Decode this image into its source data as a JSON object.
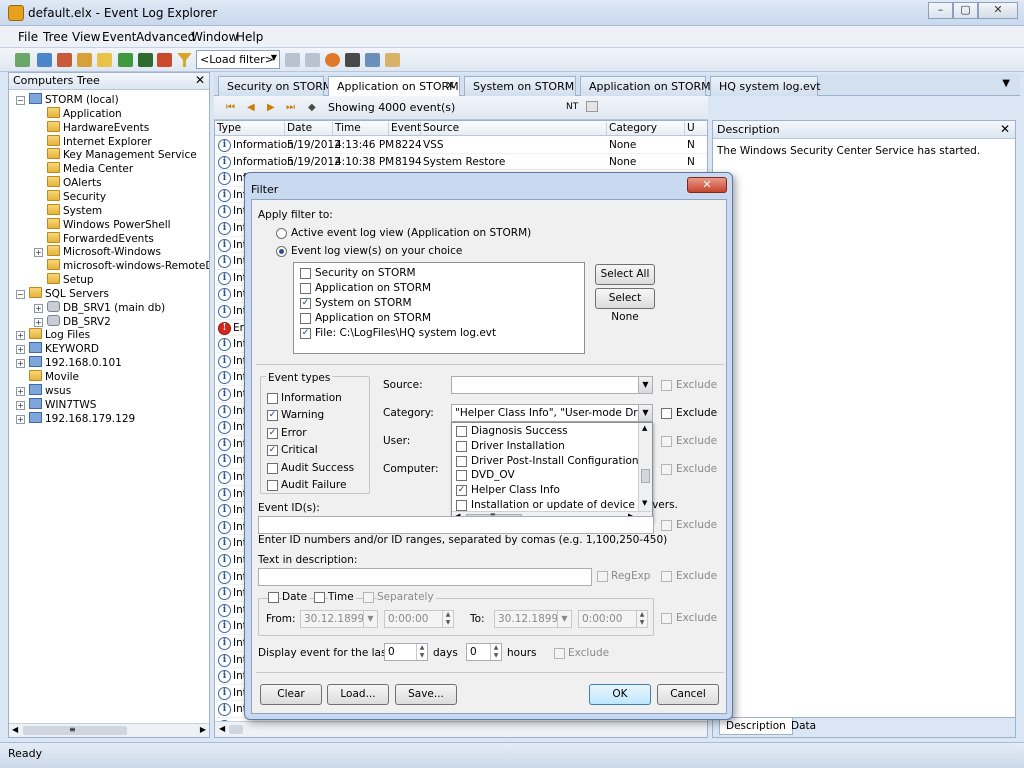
{
  "window": {
    "title": "default.elx - Event Log Explorer",
    "minimize": "–",
    "maximize": "▢",
    "close": "✕"
  },
  "menu": [
    "File",
    "Tree",
    "View",
    "Event",
    "Advanced",
    "Window",
    "Help"
  ],
  "toolbar": {
    "load_filter_value": "<Load filter>"
  },
  "left_pane": {
    "title": "Computers Tree",
    "close": "✕",
    "nodes": [
      {
        "label": "STORM (local)",
        "icon": "computer-icon",
        "indent": 1,
        "expander": "−"
      },
      {
        "label": "Application",
        "icon": "folder-icon",
        "indent": 2
      },
      {
        "label": "HardwareEvents",
        "icon": "folder-icon",
        "indent": 2
      },
      {
        "label": "Internet Explorer",
        "icon": "folder-icon",
        "indent": 2
      },
      {
        "label": "Key Management Service",
        "icon": "folder-icon",
        "indent": 2
      },
      {
        "label": "Media Center",
        "icon": "folder-icon",
        "indent": 2
      },
      {
        "label": "OAlerts",
        "icon": "folder-icon",
        "indent": 2
      },
      {
        "label": "Security",
        "icon": "folder-icon",
        "indent": 2
      },
      {
        "label": "System",
        "icon": "folder-icon",
        "indent": 2
      },
      {
        "label": "Windows PowerShell",
        "icon": "folder-icon",
        "indent": 2
      },
      {
        "label": "ForwardedEvents",
        "icon": "folder-icon",
        "indent": 2
      },
      {
        "label": "Microsoft-Windows",
        "icon": "folder-icon",
        "indent": 2,
        "expander": "+"
      },
      {
        "label": "microsoft-windows-RemoteDesktop",
        "icon": "folder-icon",
        "indent": 2
      },
      {
        "label": "Setup",
        "icon": "folder-icon",
        "indent": 2
      },
      {
        "label": "SQL Servers",
        "icon": "folder-icon",
        "indent": 1,
        "expander": "−"
      },
      {
        "label": "DB_SRV1 (main db)",
        "icon": "database-icon",
        "indent": 2,
        "expander": "+"
      },
      {
        "label": "DB_SRV2",
        "icon": "database-icon",
        "indent": 2,
        "expander": "+"
      },
      {
        "label": "Log Files",
        "icon": "folder-icon",
        "indent": 1,
        "expander": "+"
      },
      {
        "label": "KEYWORD",
        "icon": "computer-icon",
        "indent": 1,
        "expander": "+"
      },
      {
        "label": "192.168.0.101",
        "icon": "computer-icon",
        "indent": 1,
        "expander": "+"
      },
      {
        "label": "Movile",
        "icon": "folder-icon",
        "indent": 1
      },
      {
        "label": "wsus",
        "icon": "computer-icon",
        "indent": 1,
        "expander": "+"
      },
      {
        "label": "WIN7TWS",
        "icon": "computer-icon",
        "indent": 1,
        "expander": "+"
      },
      {
        "label": "192.168.179.129",
        "icon": "computer-icon",
        "indent": 1,
        "expander": "+"
      }
    ]
  },
  "tabs": [
    {
      "label": "Security on STORM",
      "active": false
    },
    {
      "label": "Application on STORM",
      "active": true
    },
    {
      "label": "System on STORM",
      "active": false
    },
    {
      "label": "Application on STORM",
      "active": false
    },
    {
      "label": "HQ system log.evt",
      "active": false
    }
  ],
  "tab_close": "✕",
  "tab_menu": "▼",
  "event_strip": {
    "count": "Showing 4000 event(s)",
    "nt": "NT"
  },
  "grid": {
    "columns": [
      "Type",
      "Date",
      "Time",
      "Event",
      "Source",
      "Category",
      "U"
    ],
    "rows": [
      {
        "type": "Information",
        "date": "5/19/2012",
        "time": "4:13:46 PM",
        "event": "8224",
        "source": "VSS",
        "category": "None",
        "u": "N",
        "icon": "info"
      },
      {
        "type": "Information",
        "date": "5/19/2012",
        "time": "4:10:38 PM",
        "event": "8194",
        "source": "System Restore",
        "category": "None",
        "u": "N",
        "icon": "info"
      },
      {
        "type": "Infor",
        "date": "",
        "time": "",
        "event": "",
        "source": "",
        "category": "",
        "u": "",
        "icon": "info"
      },
      {
        "type": "Info",
        "icon": "info"
      },
      {
        "type": "Int",
        "icon": "info"
      },
      {
        "type": "Int",
        "icon": "info"
      },
      {
        "type": "Int",
        "icon": "info"
      },
      {
        "type": "Int",
        "icon": "info"
      },
      {
        "type": "Int",
        "icon": "info"
      },
      {
        "type": "Int",
        "icon": "info"
      },
      {
        "type": "Int",
        "icon": "info"
      },
      {
        "type": "Er",
        "icon": "error"
      },
      {
        "type": "Int",
        "icon": "info"
      },
      {
        "type": "Int",
        "icon": "info"
      },
      {
        "type": "Int",
        "icon": "info"
      },
      {
        "type": "Int",
        "icon": "info"
      },
      {
        "type": "Int",
        "icon": "info"
      },
      {
        "type": "Int",
        "icon": "info"
      },
      {
        "type": "Int",
        "icon": "info"
      },
      {
        "type": "Int",
        "icon": "info"
      },
      {
        "type": "Int",
        "icon": "info"
      },
      {
        "type": "Int",
        "icon": "info"
      },
      {
        "type": "Int",
        "icon": "info"
      },
      {
        "type": "Int",
        "icon": "info"
      },
      {
        "type": "Int",
        "icon": "info"
      },
      {
        "type": "Int",
        "icon": "info"
      },
      {
        "type": "Int",
        "icon": "info"
      },
      {
        "type": "Int",
        "icon": "info"
      },
      {
        "type": "Int",
        "icon": "info"
      },
      {
        "type": "Int",
        "icon": "info"
      },
      {
        "type": "Int",
        "icon": "info"
      },
      {
        "type": "Int",
        "icon": "info"
      },
      {
        "type": "Int",
        "icon": "info"
      },
      {
        "type": "Int",
        "icon": "info"
      },
      {
        "type": "Int",
        "icon": "info"
      },
      {
        "type": "Int",
        "icon": "info"
      }
    ]
  },
  "description": {
    "title": "Description",
    "close": "✕",
    "text": "The Windows Security Center Service has started.",
    "tabs": [
      "Description",
      "Data"
    ]
  },
  "status": "Ready",
  "dialog": {
    "title": "Filter",
    "close": "✕",
    "apply_filter_to": "Apply filter to:",
    "radio_active": "Active event log view (Application on STORM)",
    "radio_choice": "Event log view(s) on your choice",
    "views": [
      {
        "label": "Security on STORM",
        "checked": false
      },
      {
        "label": "Application on STORM",
        "checked": false
      },
      {
        "label": "System on STORM",
        "checked": true
      },
      {
        "label": "Application on STORM",
        "checked": false
      },
      {
        "label": "File: C:\\LogFiles\\HQ system log.evt",
        "checked": true
      }
    ],
    "select_all": "Select All",
    "select_none": "Select None",
    "event_types_title": "Event types",
    "event_types": [
      {
        "label": "Information",
        "checked": false
      },
      {
        "label": "Warning",
        "checked": true
      },
      {
        "label": "Error",
        "checked": true
      },
      {
        "label": "Critical",
        "checked": true
      },
      {
        "label": "Audit Success",
        "checked": false
      },
      {
        "label": "Audit Failure",
        "checked": false
      }
    ],
    "source_label": "Source:",
    "source_value": "",
    "category_label": "Category:",
    "category_value": "\"Helper Class Info\", \"User-mode Driver probl",
    "user_label": "User:",
    "computer_label": "Computer:",
    "exclude": "Exclude",
    "category_options": [
      {
        "label": "Diagnosis Success",
        "checked": false
      },
      {
        "label": "Driver Installation",
        "checked": false
      },
      {
        "label": "Driver Post-Install Configuration",
        "checked": false
      },
      {
        "label": "DVD_OV",
        "checked": false
      },
      {
        "label": "Helper Class Info",
        "checked": true
      },
      {
        "label": "Installation or update of device drivers.",
        "checked": false
      }
    ],
    "event_ids_label": "Event ID(s):",
    "event_ids_hint": "Enter ID numbers and/or ID ranges, separated by comas (e.g. 1,100,250-450)",
    "text_desc_label": "Text in description:",
    "regexp": "RegExp",
    "date_label": "Date",
    "time_label": "Time",
    "separately_label": "Separately",
    "from_label": "From:",
    "to_label": "To:",
    "from_date": "30.12.1899",
    "from_time": "0:00:00",
    "to_date": "30.12.1899",
    "to_time": "0:00:00",
    "display_last_label": "Display event for the last",
    "days_value": "0",
    "days_label": "days",
    "hours_value": "0",
    "hours_label": "hours",
    "clear": "Clear",
    "load": "Load...",
    "save": "Save...",
    "ok": "OK",
    "cancel": "Cancel",
    "scroll_grip": "≡"
  }
}
